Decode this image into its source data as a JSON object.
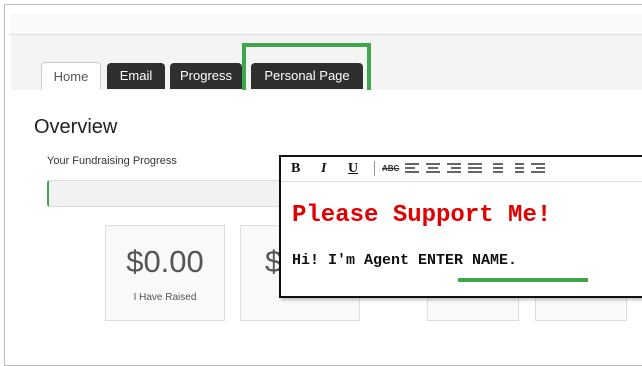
{
  "tabs": [
    {
      "label": "Home",
      "active": true
    },
    {
      "label": "Email",
      "active": false
    },
    {
      "label": "Progress",
      "active": false
    },
    {
      "label": "Personal Page",
      "active": false
    }
  ],
  "overview": {
    "title": "Overview",
    "progress_label": "Your Fundraising Progress",
    "progress_fraction": 0.0
  },
  "stats": [
    {
      "value": "$0.00",
      "label": "I Have Raised"
    },
    {
      "value": "$",
      "label": ""
    }
  ],
  "editor": {
    "toolbar": {
      "bold": "B",
      "italic": "I",
      "underline": "U",
      "spellcheck": "ABC",
      "icons": [
        "align-left-icon",
        "align-center-icon",
        "align-right-icon",
        "align-justify-icon",
        "bullet-list-icon",
        "numbered-list-icon",
        "indent-icon"
      ]
    },
    "headline": "Please Support Me!",
    "greeting_prefix": "Hi! I'm Agent ",
    "agent_name": "ENTER NAME",
    "greeting_suffix": "."
  },
  "colors": {
    "accent_green": "#3fa64a",
    "headline_red": "#e00000",
    "tab_dark": "#2f2f2f"
  }
}
